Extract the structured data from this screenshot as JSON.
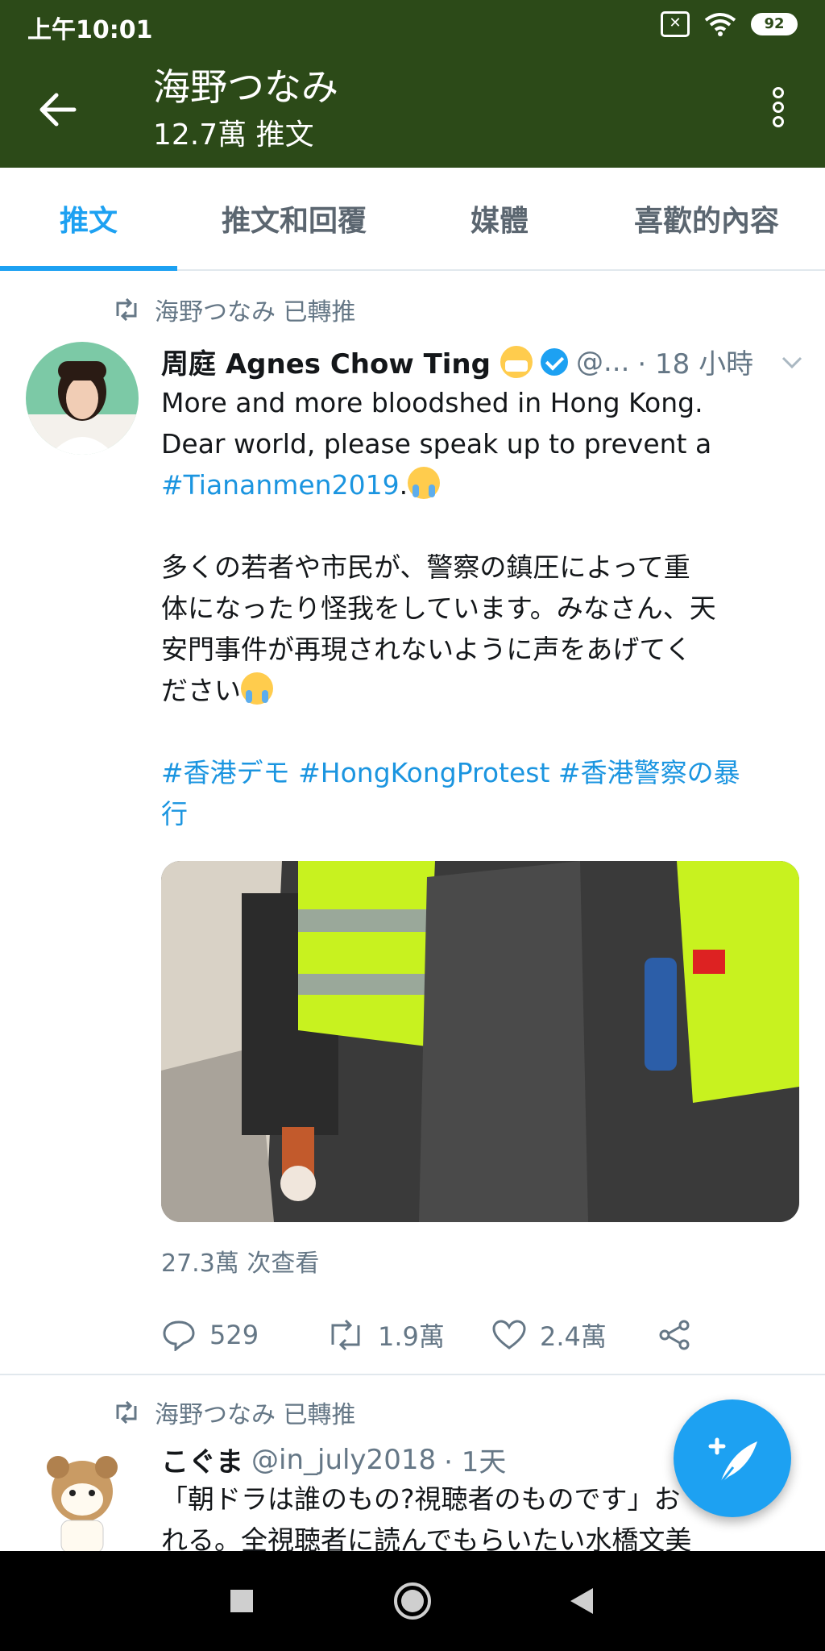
{
  "status_bar": {
    "time": "上午10:01",
    "battery": "92"
  },
  "header": {
    "title": "海野つなみ",
    "subtitle": "12.7萬 推文"
  },
  "tabs": [
    {
      "label": "推文",
      "active": true
    },
    {
      "label": "推文和回覆",
      "active": false
    },
    {
      "label": "媒體",
      "active": false
    },
    {
      "label": "喜歡的內容",
      "active": false
    }
  ],
  "tweets": [
    {
      "retweet_label": "海野つなみ 已轉推",
      "author_name": "周庭 Agnes Chow Ting",
      "handle": "@...",
      "time": "· 18 小時",
      "text_line1": "More and more bloodshed in Hong Kong.",
      "text_line2": "Dear world, please speak up to prevent a",
      "hashtag1": "#Tiananmen2019",
      "hashtag1_suffix": ".",
      "jp_line1": "多くの若者や市民が、警察の鎮圧によって重",
      "jp_line2": "体になったり怪我をしています。みなさん、天",
      "jp_line3": "安門事件が再現されないように声をあげてく",
      "jp_line4": "ださい",
      "hashtags_line1": "#香港デモ #HongKongProtest #香港警察の暴",
      "hashtags_line2": "行",
      "views": "27.3萬 次查看",
      "reply_count": "529",
      "retweet_count": "1.9萬",
      "like_count": "2.4萬"
    },
    {
      "retweet_label": "海野つなみ 已轉推",
      "author_name": "こぐま",
      "handle": "@in_july2018",
      "time": "· 1天",
      "text_line1": "「朝ドラは誰のもの?視聴者のものです」お",
      "text_line2": "れる。全視聴者に読んでもらいたい水橋文美"
    }
  ],
  "colors": {
    "header_bg": "#2c4a18",
    "accent": "#1da1f2",
    "link": "#1b95e0",
    "secondary_text": "#657786"
  },
  "icons": [
    "back-arrow-icon",
    "more-vert-icon",
    "retweet-icon",
    "verified-icon",
    "chevron-down-icon",
    "reply-icon",
    "like-icon",
    "share-icon",
    "compose-icon",
    "wifi-icon",
    "battery-icon",
    "sim-icon"
  ]
}
